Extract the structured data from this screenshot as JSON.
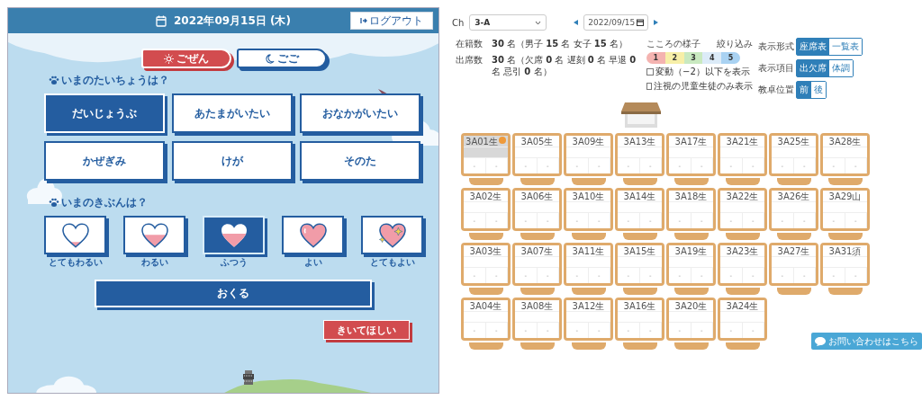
{
  "student_app": {
    "header": {
      "date": "2022年09月15日 (木)",
      "logout_label": "ログアウト"
    },
    "periods": [
      {
        "label": "ごぜん",
        "kind": "sun",
        "selected": true
      },
      {
        "label": "ごご",
        "kind": "moon",
        "selected": false
      }
    ],
    "condition": {
      "question": "いまのたいちょうは？",
      "options": [
        {
          "label": "だいじょうぶ",
          "selected": true
        },
        {
          "label": "あたまがいたい",
          "selected": false
        },
        {
          "label": "おなかがいたい",
          "selected": false
        },
        {
          "label": "かぜぎみ",
          "selected": false
        },
        {
          "label": "けが",
          "selected": false
        },
        {
          "label": "そのた",
          "selected": false
        }
      ]
    },
    "mood": {
      "question": "いまのきぶんは？",
      "options": [
        {
          "label": "とてもわるい",
          "kind": "low",
          "selected": false
        },
        {
          "label": "わるい",
          "kind": "half",
          "selected": false
        },
        {
          "label": "ふつう",
          "kind": "mid",
          "selected": true
        },
        {
          "label": "よい",
          "kind": "full",
          "selected": false
        },
        {
          "label": "とてもよい",
          "kind": "sparkle",
          "selected": false
        }
      ]
    },
    "send_button": "おくる",
    "listen_button": "きいてほしい"
  },
  "teacher_view": {
    "class_label": "Ch",
    "class_select": "3-A",
    "date": "2022/09/15",
    "stats": [
      {
        "label": "在籍数",
        "value": "**30** 名（男子 **15** 名 女子 **15** 名）"
      },
      {
        "label": "出席数",
        "value": "**30** 名（欠席 **0** 名 遅刻 **0** 名 早退 **0** 名 忌引 **0** 名）"
      }
    ],
    "filter": {
      "title": "こころの様子",
      "action": "絞り込み",
      "levels": [
        {
          "label": "1",
          "color": "#f4b3b0"
        },
        {
          "label": "2",
          "color": "#f7efa8"
        },
        {
          "label": "3",
          "color": "#c9e9c0"
        },
        {
          "label": "4",
          "color": "#dcebf8"
        },
        {
          "label": "5",
          "color": "#a9d2f2"
        }
      ],
      "checkboxes": [
        {
          "label": "変動（−2）以下を表示",
          "checked": false
        },
        {
          "label": "注視の児童生徒のみ表示",
          "checked": false
        }
      ]
    },
    "settings": [
      {
        "label": "表示形式",
        "options": [
          {
            "label": "座席表",
            "selected": true
          },
          {
            "label": "一覧表",
            "selected": false
          }
        ]
      },
      {
        "label": "表示項目",
        "options": [
          {
            "label": "出欠席",
            "selected": true
          },
          {
            "label": "体調",
            "selected": false
          }
        ]
      },
      {
        "label": "教卓位置",
        "options": [
          {
            "label": "前",
            "selected": true
          },
          {
            "label": "後",
            "selected": false
          }
        ]
      }
    ],
    "seat_rows": [
      [
        {
          "name": "3A01生",
          "flagged": true,
          "cells": [
            "-",
            "-"
          ]
        },
        {
          "name": "3A05生",
          "flagged": false,
          "cells": [
            "-",
            "-"
          ]
        },
        {
          "name": "3A09生",
          "flagged": false,
          "cells": [
            "-",
            "-"
          ]
        },
        {
          "name": "3A13生",
          "flagged": false,
          "cells": [
            "-",
            "-"
          ]
        },
        {
          "name": "3A17生",
          "flagged": false,
          "cells": [
            "-",
            "-"
          ]
        },
        {
          "name": "3A21生",
          "flagged": false,
          "cells": [
            "-",
            "-"
          ]
        },
        {
          "name": "3A25生",
          "flagged": false,
          "cells": [
            "-",
            "-"
          ]
        },
        {
          "name": "3A28生",
          "flagged": false,
          "cells": [
            "-",
            "-"
          ]
        }
      ],
      [
        {
          "name": "3A02生",
          "flagged": false,
          "cells": [
            "-",
            "-"
          ]
        },
        {
          "name": "3A06生",
          "flagged": false,
          "cells": [
            "-",
            "-"
          ]
        },
        {
          "name": "3A10生",
          "flagged": false,
          "cells": [
            "-",
            "-"
          ]
        },
        {
          "name": "3A14生",
          "flagged": false,
          "cells": [
            "-",
            "-"
          ]
        },
        {
          "name": "3A18生",
          "flagged": false,
          "cells": [
            "-",
            "-"
          ]
        },
        {
          "name": "3A22生",
          "flagged": false,
          "cells": [
            "-",
            "-"
          ]
        },
        {
          "name": "3A26生",
          "flagged": false,
          "cells": [
            "-",
            "-"
          ]
        },
        {
          "name": "3A29山",
          "flagged": false,
          "cells": [
            "-",
            "-"
          ]
        }
      ],
      [
        {
          "name": "3A03生",
          "flagged": false,
          "cells": [
            "-",
            "-"
          ]
        },
        {
          "name": "3A07生",
          "flagged": false,
          "cells": [
            "-",
            "-"
          ]
        },
        {
          "name": "3A11生",
          "flagged": false,
          "cells": [
            "-",
            "-"
          ]
        },
        {
          "name": "3A15生",
          "flagged": false,
          "cells": [
            "-",
            "-"
          ]
        },
        {
          "name": "3A19生",
          "flagged": false,
          "cells": [
            "-",
            "-"
          ]
        },
        {
          "name": "3A23生",
          "flagged": false,
          "cells": [
            "-",
            "-"
          ]
        },
        {
          "name": "3A27生",
          "flagged": false,
          "cells": [
            "-",
            "-"
          ]
        },
        {
          "name": "3A31須",
          "flagged": false,
          "cells": [
            "-",
            "-"
          ]
        }
      ],
      [
        {
          "name": "3A04生",
          "flagged": false,
          "cells": [
            "-",
            "-"
          ]
        },
        {
          "name": "3A08生",
          "flagged": false,
          "cells": [
            "-",
            "-"
          ]
        },
        {
          "name": "3A12生",
          "flagged": false,
          "cells": [
            "-",
            "-"
          ]
        },
        {
          "name": "3A16生",
          "flagged": false,
          "cells": [
            "-",
            "-"
          ]
        },
        {
          "name": "3A20生",
          "flagged": false,
          "cells": [
            "-",
            "-"
          ]
        },
        {
          "name": "3A24生",
          "flagged": false,
          "cells": [
            "-",
            "-"
          ]
        }
      ]
    ],
    "help_button": "お問い合わせはこちら"
  }
}
